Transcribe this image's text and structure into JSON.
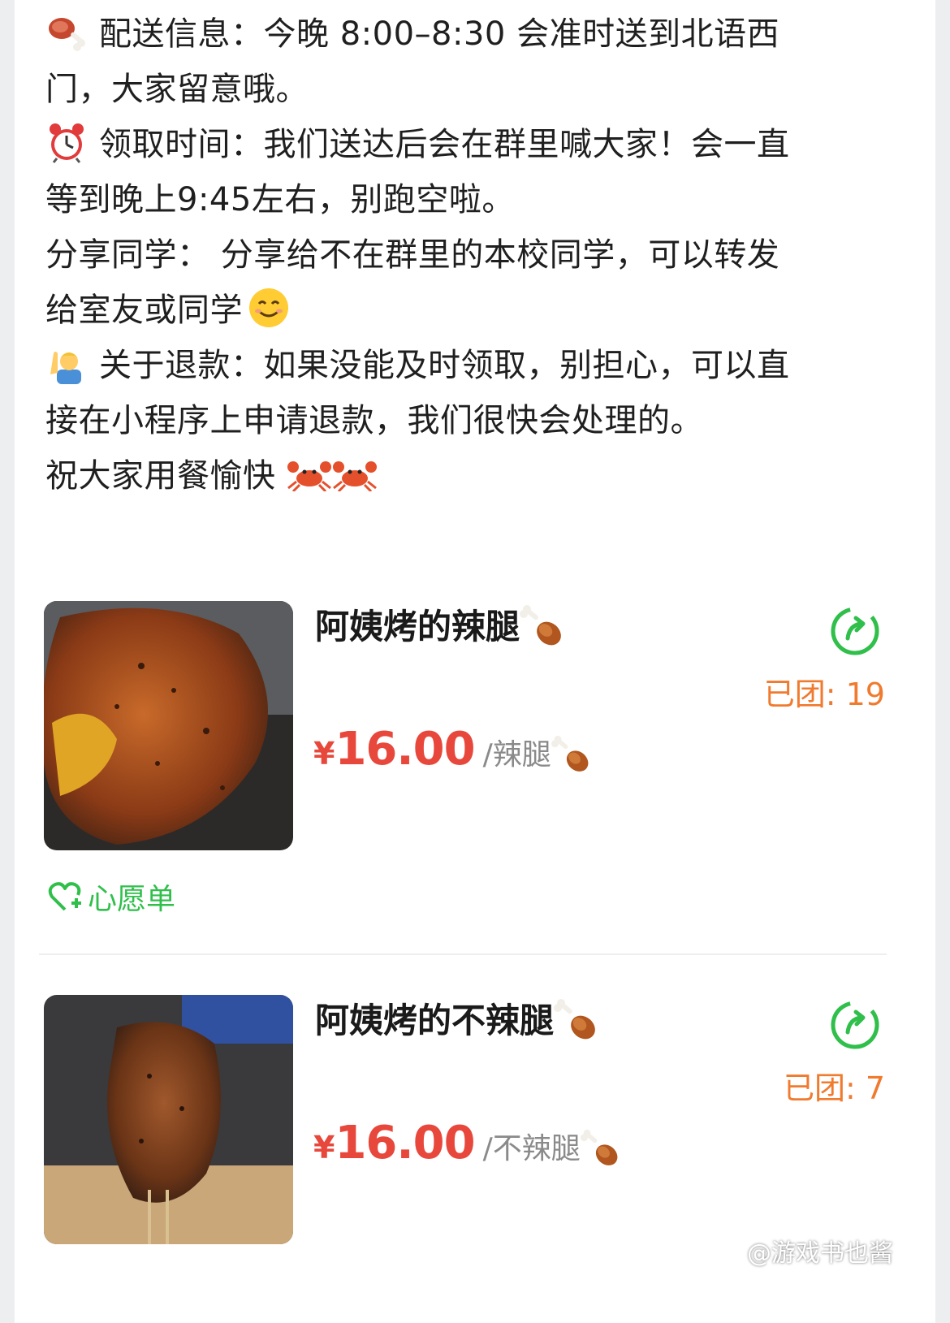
{
  "notice": {
    "line1": "配送信息：今晚 8:00–8:30 会准时送到北语西",
    "line2": "门，大家留意哦。",
    "line3": "领取时间：我们送达后会在群里喊大家！会一直",
    "line4": "等到晚上9:45左右，别跑空啦。",
    "line5": "分享同学：  分享给不在群里的本校同学，可以转发",
    "line6": "给室友或同学",
    "line7": "关于退款：如果没能及时领取，别担心，可以直",
    "line8": "接在小程序上申请退款，我们很快会处理的。",
    "line9": "祝大家用餐愉快",
    "icons": [
      "meat-on-bone-icon",
      "alarm-clock-icon",
      "smiling-face-icon",
      "person-raising-hand-icon",
      "crab-icon",
      "crab-icon"
    ]
  },
  "products": [
    {
      "title": "阿姨烤的辣腿",
      "group_count": "已团: 19",
      "currency": "¥",
      "price": "16.00",
      "unit": "/辣腿"
    },
    {
      "title": "阿姨烤的不辣腿",
      "group_count": "已团: 7",
      "currency": "¥",
      "price": "16.00",
      "unit": "/不辣腿"
    }
  ],
  "wishlist_label": "心愿单",
  "watermark": "@游戏书也酱",
  "colors": {
    "accent_green": "#2fbf4a",
    "price_red": "#e8473b",
    "group_orange": "#f07a2e"
  }
}
